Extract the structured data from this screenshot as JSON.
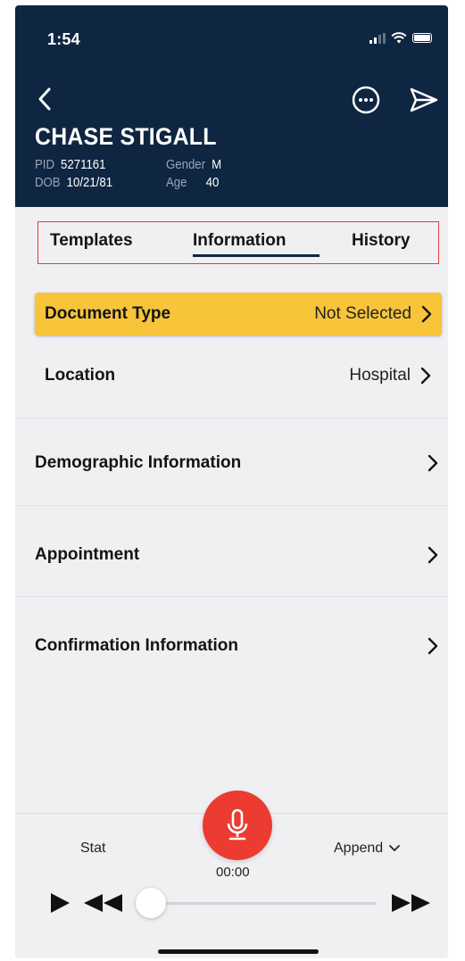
{
  "status_bar": {
    "time": "1:54"
  },
  "patient": {
    "name": "CHASE STIGALL",
    "pid_label": "PID",
    "pid": "5271161",
    "dob_label": "DOB",
    "dob": "10/21/81",
    "gender_label": "Gender",
    "gender": "M",
    "age_label": "Age",
    "age": "40"
  },
  "tabs": [
    {
      "label": "Templates",
      "active": false
    },
    {
      "label": "Information",
      "active": true
    },
    {
      "label": "History",
      "active": false
    }
  ],
  "rows": {
    "document_type": {
      "label": "Document Type",
      "value": "Not Selected"
    },
    "location": {
      "label": "Location",
      "value": "Hospital"
    },
    "demographic": {
      "label": "Demographic Information"
    },
    "appointment": {
      "label": "Appointment"
    },
    "confirmation": {
      "label": "Confirmation Information"
    }
  },
  "player": {
    "stat_label": "Stat",
    "append_label": "Append",
    "timer": "00:00",
    "progress": 0
  },
  "colors": {
    "header_bg": "#0f2642",
    "accent_yellow": "#f7c43a",
    "record_red": "#ec3b30",
    "highlight_box": "#e23b3b"
  },
  "icons": [
    "back-icon",
    "more-icon",
    "send-icon",
    "chevron-right-icon",
    "microphone-icon",
    "play-icon",
    "rewind-icon",
    "fast-forward-icon",
    "chevron-down-icon",
    "signal-icon",
    "wifi-icon",
    "battery-icon"
  ]
}
